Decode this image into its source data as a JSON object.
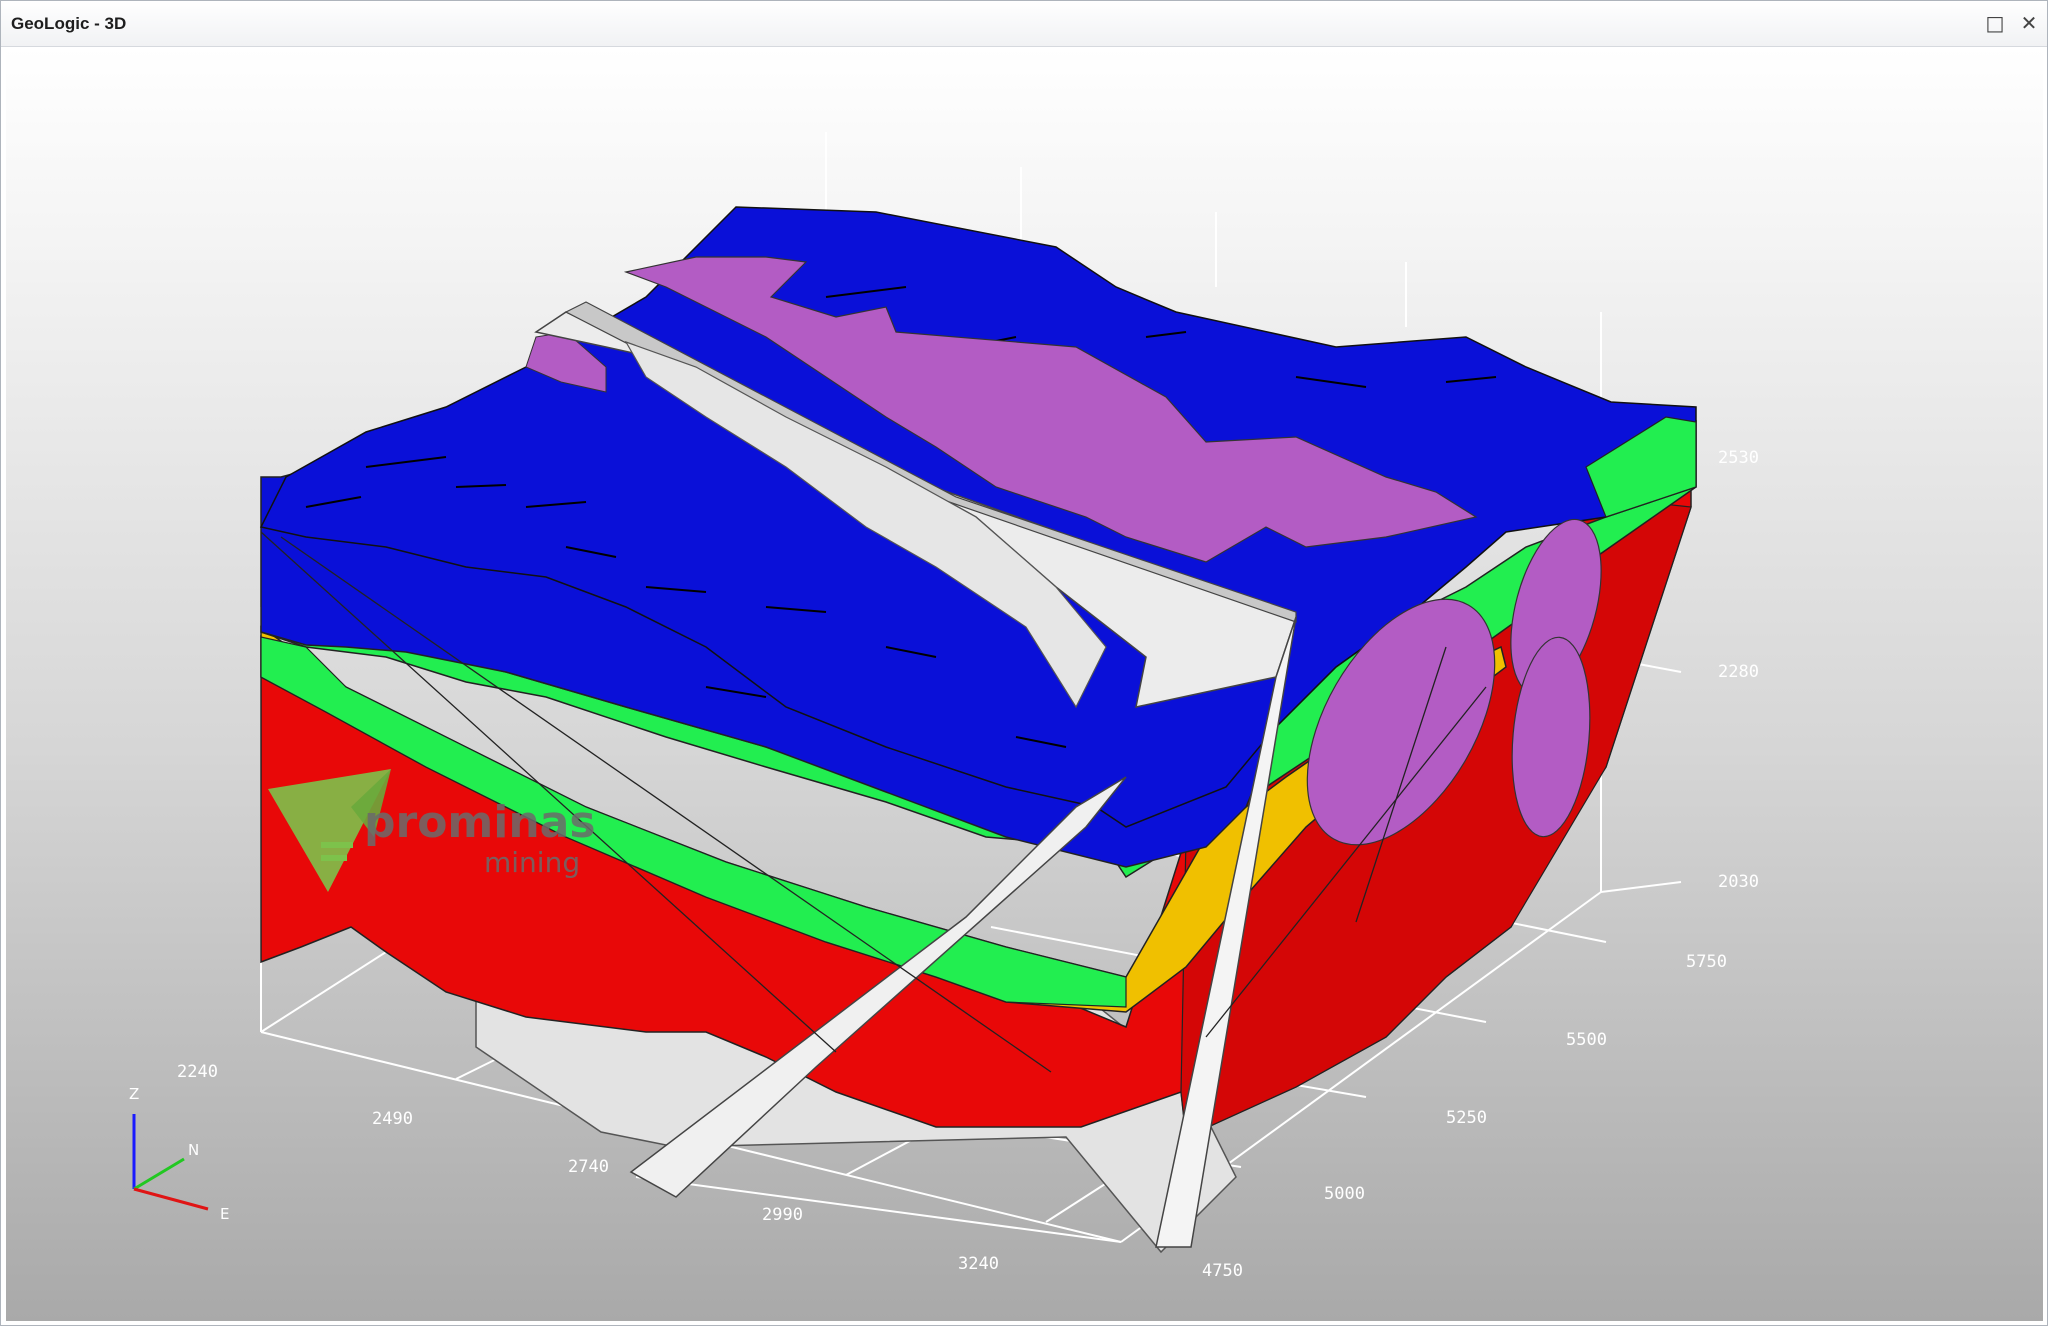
{
  "window": {
    "title": "GeoLogic - 3D",
    "maximize_icon": "maximize-icon",
    "close_icon": "close-icon"
  },
  "axes": {
    "z_ticks": [
      "2530",
      "2280",
      "2030"
    ],
    "n_ticks": [
      "5750",
      "5500",
      "5250",
      "5000",
      "4750"
    ],
    "e_ticks": [
      "2240",
      "2490",
      "2740",
      "2990",
      "3240"
    ]
  },
  "orientation_triad": {
    "z": "Z",
    "n": "N",
    "e": "E",
    "colors": {
      "z": "#1a1aff",
      "n": "#22c822",
      "e": "#e01414"
    }
  },
  "logo": {
    "name": "prominas",
    "tagline": "mining",
    "icon": "prominas-logo-icon",
    "color": "#7dc24b"
  },
  "layer_colors": {
    "top_blue": "#0a10d8",
    "intrusion_purple": "#b35cc4",
    "green": "#22ee50",
    "yellow": "#f0c000",
    "red": "#e80808",
    "fault_white": "#ececec"
  }
}
